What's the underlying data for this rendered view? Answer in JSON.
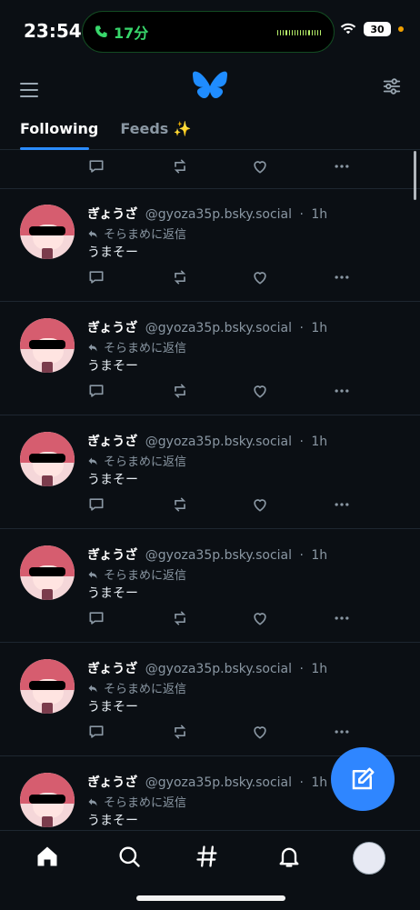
{
  "status_bar": {
    "time": "23:54",
    "call": "17分",
    "battery": "30"
  },
  "header": {
    "tabs": [
      "Following",
      "Feeds ✨"
    ]
  },
  "posts": [
    {
      "name": "ぎょうざ",
      "handle": "@gyoza35p.bsky.social",
      "time": "1h",
      "reply_to": "そらまめに返信",
      "text": "うまそー"
    },
    {
      "name": "ぎょうざ",
      "handle": "@gyoza35p.bsky.social",
      "time": "1h",
      "reply_to": "そらまめに返信",
      "text": "うまそー"
    },
    {
      "name": "ぎょうざ",
      "handle": "@gyoza35p.bsky.social",
      "time": "1h",
      "reply_to": "そらまめに返信",
      "text": "うまそー"
    },
    {
      "name": "ぎょうざ",
      "handle": "@gyoza35p.bsky.social",
      "time": "1h",
      "reply_to": "そらまめに返信",
      "text": "うまそー"
    },
    {
      "name": "ぎょうざ",
      "handle": "@gyoza35p.bsky.social",
      "time": "1h",
      "reply_to": "そらまめに返信",
      "text": "うまそー"
    },
    {
      "name": "ぎょうざ",
      "handle": "@gyoza35p.bsky.social",
      "time": "1h",
      "reply_to": "そらまめに返信",
      "text": "うまそー"
    }
  ]
}
